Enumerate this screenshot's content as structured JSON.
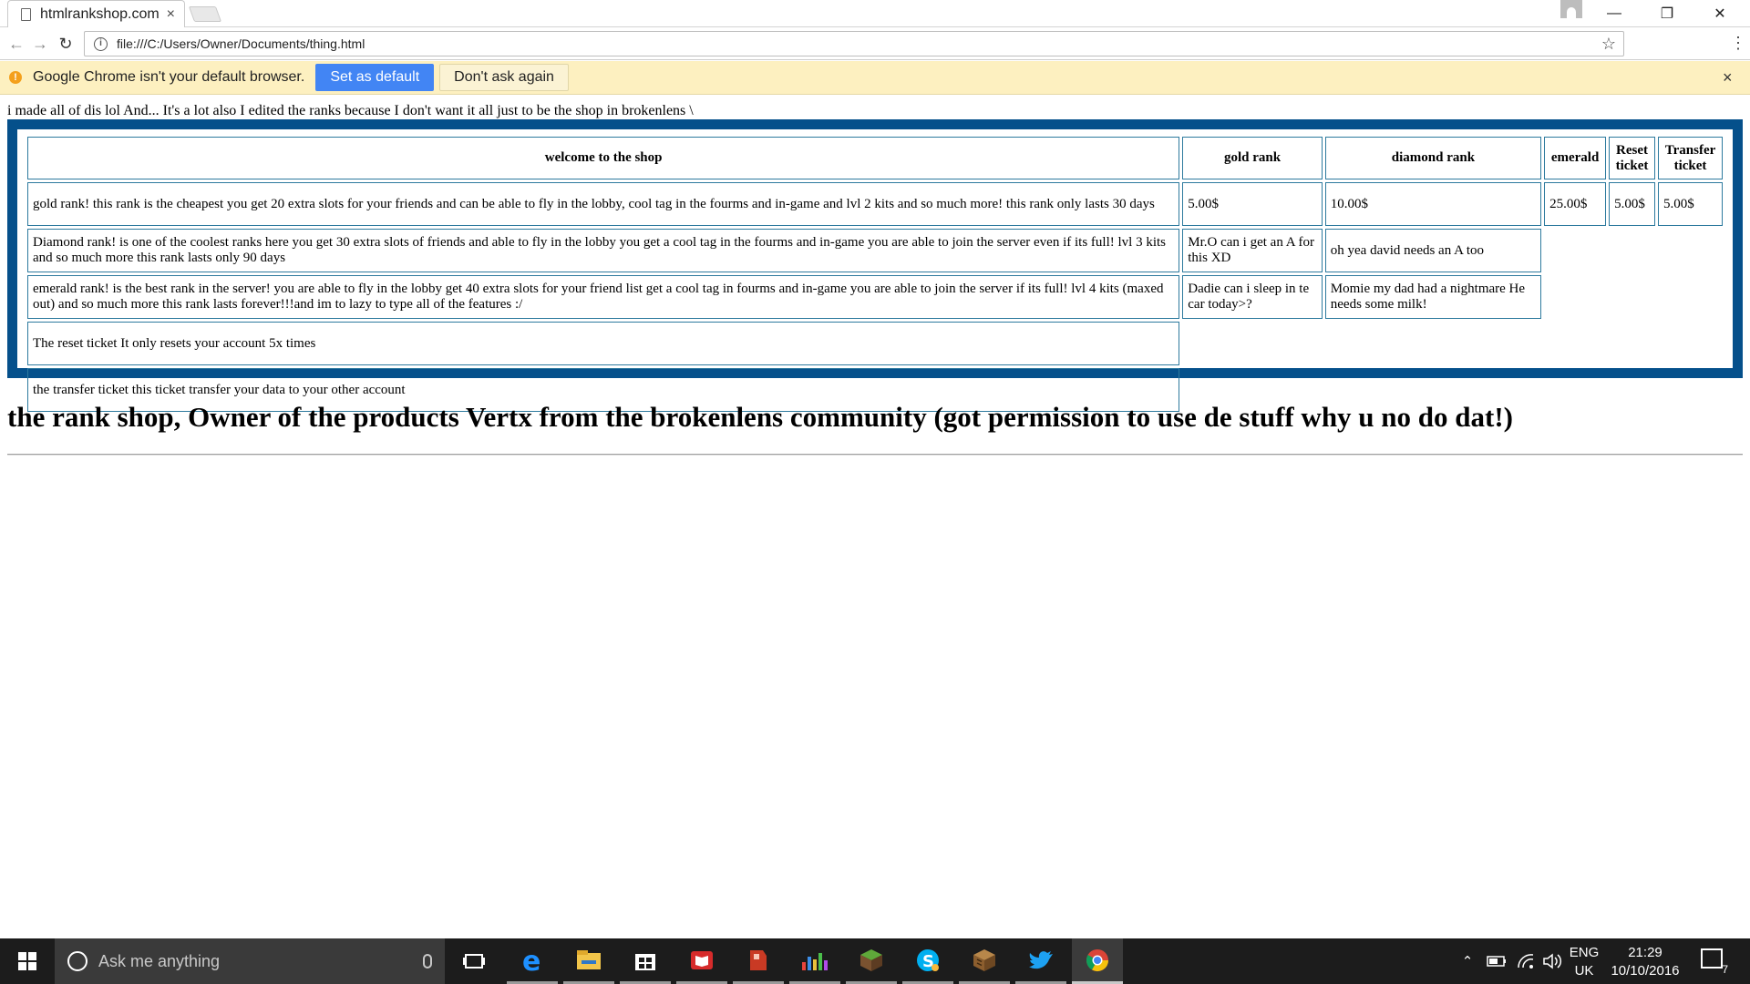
{
  "browser": {
    "tab_title": "htmlrankshop.com",
    "tab_close": "×",
    "address_url": "file:///C:/Users/Owner/Documents/thing.html",
    "infobar": {
      "message": "Google Chrome isn't your default browser.",
      "set_default_label": "Set as default",
      "dont_ask_label": "Don't ask again",
      "close": "×"
    }
  },
  "page": {
    "intro_text": "i made all of dis lol And... It's a lot also I edited the ranks because I don't want it all just to be the shop in brokenlens \\",
    "table": {
      "headers": [
        "welcome to the shop",
        "gold rank",
        "diamond rank",
        "emerald",
        "Reset ticket",
        "Transfer ticket"
      ],
      "rows": [
        [
          "gold rank! this rank is the cheapest you get 20 extra slots for your friends and can be able to fly in the lobby, cool tag in the fourms and in-game and lvl 2 kits and so much more! this rank only lasts 30 days",
          "5.00$",
          "10.00$",
          "25.00$",
          "5.00$",
          "5.00$"
        ],
        [
          "Diamond rank! is one of the coolest ranks here you get 30 extra slots of friends and able to fly in the lobby you get a cool tag in the fourms and in-game you are able to join the server even if its full! lvl 3 kits and so much more this rank lasts only 90 days",
          "Mr.O can i get an A for this XD",
          "oh yea david needs an A too"
        ],
        [
          "emerald rank! is the best rank in the server! you are able to fly in the lobby get 40 extra slots for your friend list get a cool tag in fourms and in-game you are able to join the server if its full! lvl 4 kits (maxed out) and so much more this rank lasts forever!!!and im to lazy to type all of the features :/",
          "Dadie can i sleep in te car today>?",
          "Momie my dad had a nightmare He needs some milk!"
        ],
        [
          "The reset ticket It only resets your account 5x times"
        ],
        [
          "the transfer ticket this ticket transfer your data to your other account"
        ]
      ]
    },
    "heading": "the rank shop, Owner of the products Vertx from the brokenlens community (got permission to use de stuff why u no do dat!)"
  },
  "taskbar": {
    "search_placeholder": "Ask me anything",
    "language_line1": "ENG",
    "language_line2": "UK",
    "time": "21:29",
    "date": "10/10/2016",
    "notification_count": "7",
    "accent_color": "#05508b"
  }
}
